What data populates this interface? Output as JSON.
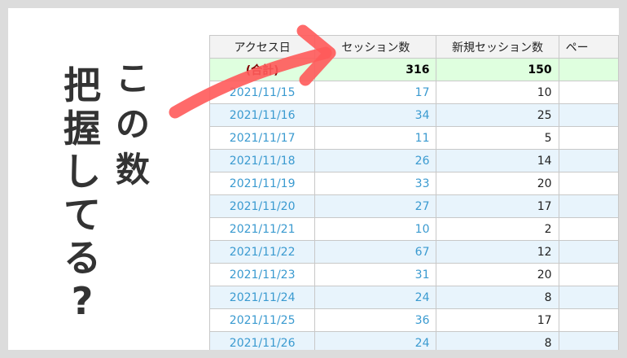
{
  "caption": {
    "line1": [
      "こ",
      "の",
      "数"
    ],
    "line2": [
      "把",
      "握",
      "し",
      "て",
      "る",
      "?"
    ]
  },
  "table": {
    "headers": [
      "アクセス日",
      "セッション数",
      "新規セッション数",
      "ペー"
    ],
    "total": {
      "label": "(合計)",
      "sessions": "316",
      "new_sessions": "150"
    },
    "rows": [
      {
        "date": "2021/11/15",
        "sessions": "17",
        "new_sessions": "10"
      },
      {
        "date": "2021/11/16",
        "sessions": "34",
        "new_sessions": "25"
      },
      {
        "date": "2021/11/17",
        "sessions": "11",
        "new_sessions": "5"
      },
      {
        "date": "2021/11/18",
        "sessions": "26",
        "new_sessions": "14"
      },
      {
        "date": "2021/11/19",
        "sessions": "33",
        "new_sessions": "20"
      },
      {
        "date": "2021/11/20",
        "sessions": "27",
        "new_sessions": "17"
      },
      {
        "date": "2021/11/21",
        "sessions": "10",
        "new_sessions": "2"
      },
      {
        "date": "2021/11/22",
        "sessions": "67",
        "new_sessions": "12"
      },
      {
        "date": "2021/11/23",
        "sessions": "31",
        "new_sessions": "20"
      },
      {
        "date": "2021/11/24",
        "sessions": "24",
        "new_sessions": "8"
      },
      {
        "date": "2021/11/25",
        "sessions": "36",
        "new_sessions": "17"
      },
      {
        "date": "2021/11/26",
        "sessions": "24",
        "new_sessions": "8"
      }
    ]
  },
  "colors": {
    "arrow": "#ff5a5a"
  }
}
